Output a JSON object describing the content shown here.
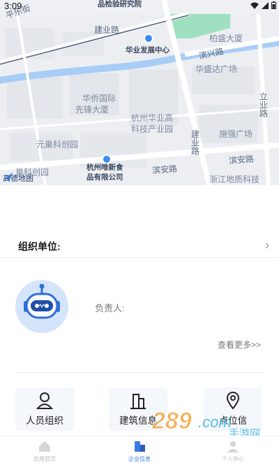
{
  "status_bar": {
    "time": "3:09",
    "icons": [
      "wifi-icon",
      "signal-icon",
      "battery-icon"
    ]
  },
  "map": {
    "provider": "高德地图",
    "roads": {
      "jianye_road_top": "建业路",
      "jianye_road_vertical": "建业路",
      "binxing_road": "滨兴路",
      "binan_road_right": "滨安路",
      "binan_road_center": "滨安路",
      "lixing_road": "立业路",
      "pingle_street": "平乐街"
    },
    "labels": {
      "research_institute": "品检验研究院",
      "huaye_center": "华业发展中心",
      "baisheng": "柏盛大厦",
      "huashengda": "华盛达广场",
      "huaqiao_1": "华侨国际",
      "huaqiao_2": "先锋大厦",
      "hangzhou_huaye_1": "杭州华业高",
      "hangzhou_huaye_2": "科技产业园",
      "shiqiang": "施强广场",
      "yuanchao": "元巢科创园",
      "weixin_1": "杭州唯新食",
      "weixin_2": "品有限公司",
      "zhejiang_dizhi": "浙江地质科技",
      "bottom_left": "巢科创园"
    }
  },
  "org": {
    "label": "组织单位:"
  },
  "responsible": {
    "label": "负责人:"
  },
  "more": {
    "label": "查看更多>>"
  },
  "tiles": [
    {
      "label": "人员组织",
      "icon": "person-icon"
    },
    {
      "label": "建筑信息",
      "icon": "building-icon"
    },
    {
      "label": "点位信",
      "icon": "location-pin-icon"
    }
  ],
  "tabbar": [
    {
      "label": "应用首页",
      "icon": "home-icon",
      "active": false
    },
    {
      "label": "企业信息",
      "icon": "enterprise-icon",
      "active": true
    },
    {
      "label": "个人中心",
      "icon": "profile-icon",
      "active": false
    }
  ],
  "watermark": {
    "text": "289.com",
    "sub": "手游网"
  },
  "colors": {
    "accent": "#3b7be6",
    "river": "#a8cdf6",
    "park": "#9fe0c0",
    "road": "#ffffff",
    "map_bg": "#eef0f3"
  }
}
